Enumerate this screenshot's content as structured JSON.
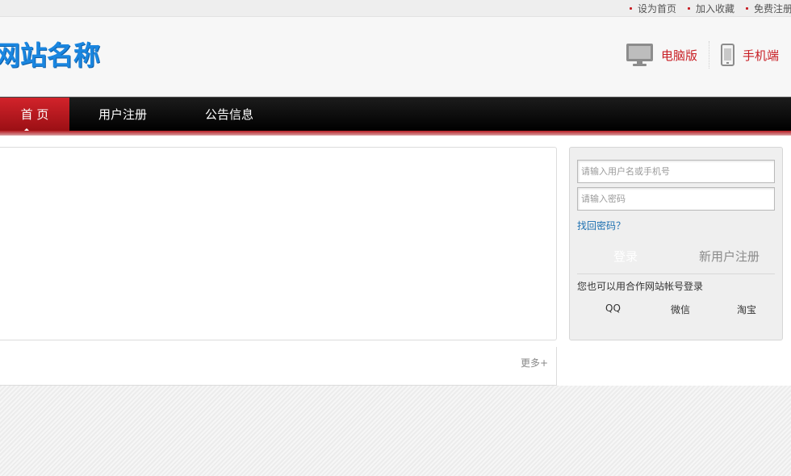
{
  "topbar": {
    "links": [
      "设为首页",
      "加入收藏",
      "免费注册"
    ]
  },
  "header": {
    "logo_text": "网站名称",
    "versions": {
      "pc": {
        "label": "电脑版",
        "icon": "monitor-icon"
      },
      "mobile": {
        "label": "手机端",
        "icon": "mobile-phone-icon"
      }
    }
  },
  "nav": {
    "items": [
      "首 页",
      "用户注册",
      "公告信息"
    ],
    "active_index": 0
  },
  "main": {
    "more_label": "更多+"
  },
  "login": {
    "username_placeholder": "请输入用户名或手机号",
    "password_placeholder": "请输入密码",
    "forgot_label": "找回密码？",
    "login_label": "登录",
    "register_label": "新用户注册",
    "partner_text": "您也可以用合作网站帐号登录",
    "partners": [
      "QQ",
      "微信",
      "淘宝"
    ]
  },
  "colors": {
    "accent": "#c81e24",
    "logo": "#1a86e0",
    "link": "#1b6fb0"
  }
}
